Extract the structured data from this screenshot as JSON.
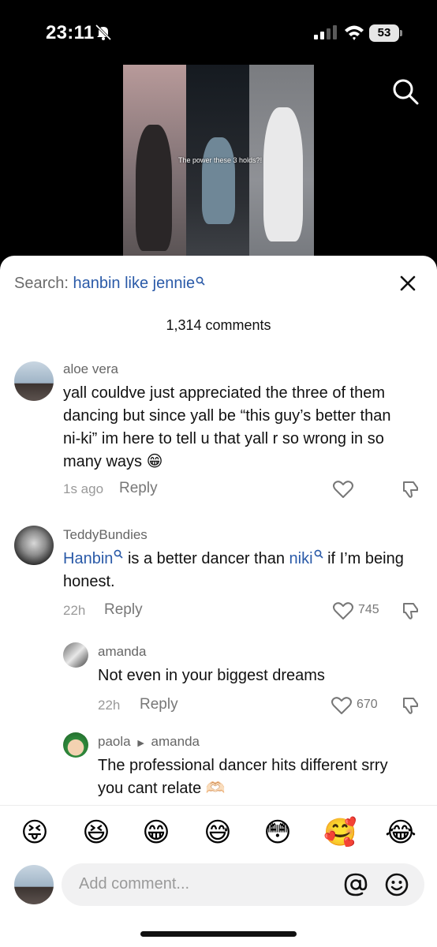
{
  "status_bar": {
    "time": "23:11",
    "battery": "53"
  },
  "video": {
    "caption": "The power these 3 holds?!"
  },
  "sheet": {
    "search_label": "Search:",
    "search_query": "hanbin like jennie",
    "comments_count": "1,314 comments"
  },
  "comments": [
    {
      "username": "aloe vera",
      "text": "yall couldve just appreciated the three of them dancing but since yall be “this guy’s better than ni-ki” im here to tell u that yall r so wrong in so many ways 😁",
      "time": "1s ago",
      "reply": "Reply",
      "likes": ""
    },
    {
      "username": "TeddyBundies",
      "text_part1": "Hanbin",
      "text_part2": " is a better dancer than ",
      "text_part3": "niki",
      "text_part4": " if I’m being honest.",
      "time": "22h",
      "reply": "Reply",
      "likes": "745"
    },
    {
      "username": "amanda",
      "text": "Not even in your biggest dreams",
      "time": "22h",
      "reply": "Reply",
      "likes": "670"
    },
    {
      "username": "paola",
      "reply_to": "amanda",
      "text": "The professional dancer hits different srry you cant relate 🫶🏻"
    }
  ],
  "emoji_bar": [
    "😝",
    "😆",
    "😁",
    "😅",
    "😳",
    "🥰",
    "😂"
  ],
  "composer": {
    "placeholder": "Add comment..."
  },
  "colors": {
    "link": "#2a5aa8",
    "sheet_bg": "#ffffff",
    "muted": "#999999"
  }
}
